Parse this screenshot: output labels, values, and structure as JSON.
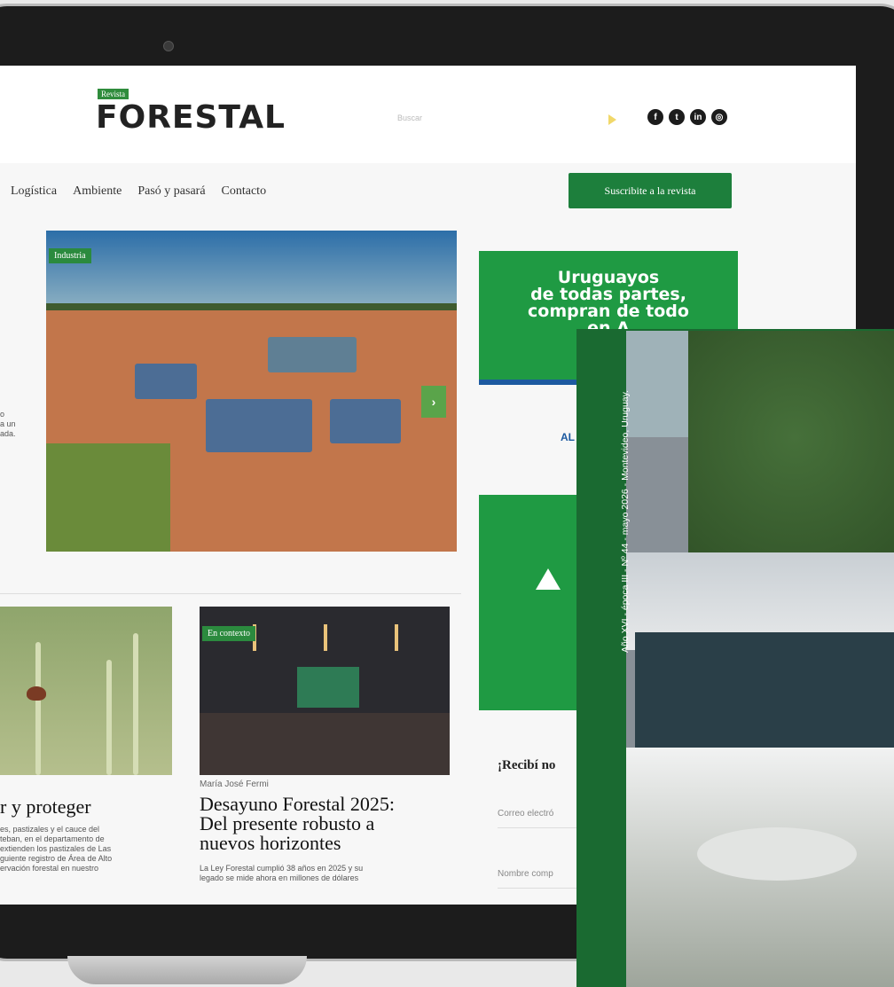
{
  "site": {
    "logo_small": "Revista",
    "logo": "FORESTAL",
    "search_placeholder": "Buscar",
    "social_icons": [
      "facebook-icon",
      "twitter-icon",
      "linkedin-icon",
      "instagram-icon"
    ],
    "social_glyphs": [
      "f",
      "t",
      "in",
      "◎"
    ]
  },
  "nav": {
    "items": [
      "Logística",
      "Ambiente",
      "Pasó y pasará",
      "Contacto"
    ],
    "subscribe_label": "Suscribite a la revista"
  },
  "hero": {
    "tag": "Industria",
    "left_fragment": [
      "o",
      "a un",
      "ada."
    ]
  },
  "ads": {
    "ad1_lines": [
      "Uruguayos",
      "de todas partes,",
      "compran de todo",
      "en A"
    ],
    "ad1_logo_fragment": "AL"
  },
  "newsletter": {
    "title": "¡Recibí no",
    "email_placeholder": "Correo electró",
    "name_placeholder": "Nombre comp"
  },
  "cards": [
    {
      "headline": "r y proteger",
      "excerpt": [
        "es, pastizales y el cauce del",
        "teban, en el departamento de",
        "extienden los pastizales de Las",
        "guiente registro de Área de Alto",
        "ervación forestal en nuestro"
      ]
    },
    {
      "tag": "En contexto",
      "author": "María José Fermi",
      "headline": [
        "Desayuno Forestal 2025:",
        "Del presente robusto a",
        "nuevos horizontes"
      ],
      "excerpt": [
        "La Ley Forestal cumplió 38 años en 2025 y su",
        "legado se mide ahora en millones de dólares"
      ]
    }
  ],
  "magazine": {
    "vertical_text": "Año XVI - época III - Nº 44 - mayo 2026 - Montevideo, Uruguay."
  },
  "colors": {
    "brand_green": "#1d7f3c",
    "ad_green": "#1f9a43",
    "magazine_green": "#1a6a31"
  }
}
